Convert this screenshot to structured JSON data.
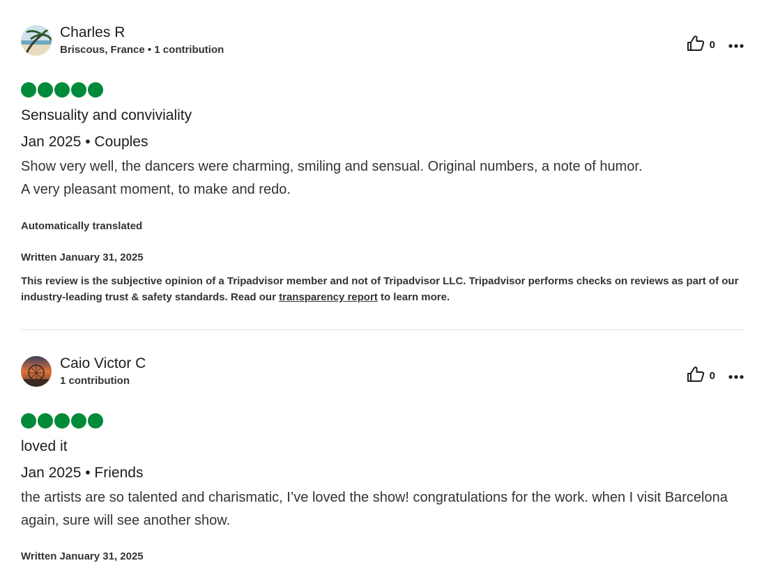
{
  "colors": {
    "bubble": "#008a39",
    "text": "#1c1c1c",
    "divider": "#e0e0e0"
  },
  "reviews": [
    {
      "user_name": "Charles R",
      "user_meta": "Briscous, France • 1 contribution",
      "helpful_count": "0",
      "rating": 5,
      "title": "Sensuality and conviviality",
      "trip": "Jan 2025 • Couples",
      "body_line1": "Show very well, the dancers were charming, smiling and sensual. Original numbers, a note of humor.",
      "body_line2": "A very pleasant moment, to make and redo.",
      "translated": "Automatically translated",
      "written": "Written January 31, 2025",
      "disclaimer_pre": "This review is the subjective opinion of a Tripadvisor member and not of Tripadvisor LLC. Tripadvisor performs checks on reviews as part of our industry-leading trust & safety standards. Read our ",
      "disclaimer_link": "transparency report",
      "disclaimer_post": " to learn more."
    },
    {
      "user_name": "Caio Victor C",
      "user_meta": "1 contribution",
      "helpful_count": "0",
      "rating": 5,
      "title": "loved it",
      "trip": "Jan 2025 • Friends",
      "body": "the artists are so talented and charismatic, I’ve loved the show! congratulations for the work. when I visit Barcelona again, sure will see another show.",
      "written": "Written January 31, 2025"
    }
  ]
}
